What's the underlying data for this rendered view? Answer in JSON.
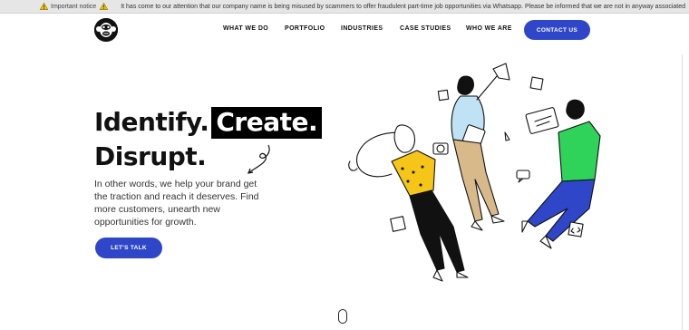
{
  "notice": {
    "label": "Important notice",
    "message": "It has come to our attention that our company name is being misused by scammers to offer fraudulent part-time job opportunities via Whatsapp. Please be informed that we are not in anyway associated"
  },
  "nav": {
    "items": [
      "WHAT WE DO",
      "PORTFOLIO",
      "INDUSTRIES",
      "CASE STUDIES",
      "WHO WE ARE"
    ],
    "contact_label": "CONTACT US"
  },
  "hero": {
    "title_part1": "Identify.",
    "title_highlight": "Create.",
    "title_line2": "Disrupt.",
    "description": "In other words, we help your brand get the traction and reach it deserves. Find more customers, unearth new opportunities for growth.",
    "cta_label": "LET'S TALK"
  },
  "colors": {
    "accent": "#2f46c9",
    "yellow": "#f5c518",
    "green": "#2fd35a",
    "light_blue": "#bfe3f5",
    "tan": "#d8b98a"
  },
  "icons": [
    "warning-icon",
    "logo-monkey-icon",
    "scroll-mouse-icon"
  ]
}
